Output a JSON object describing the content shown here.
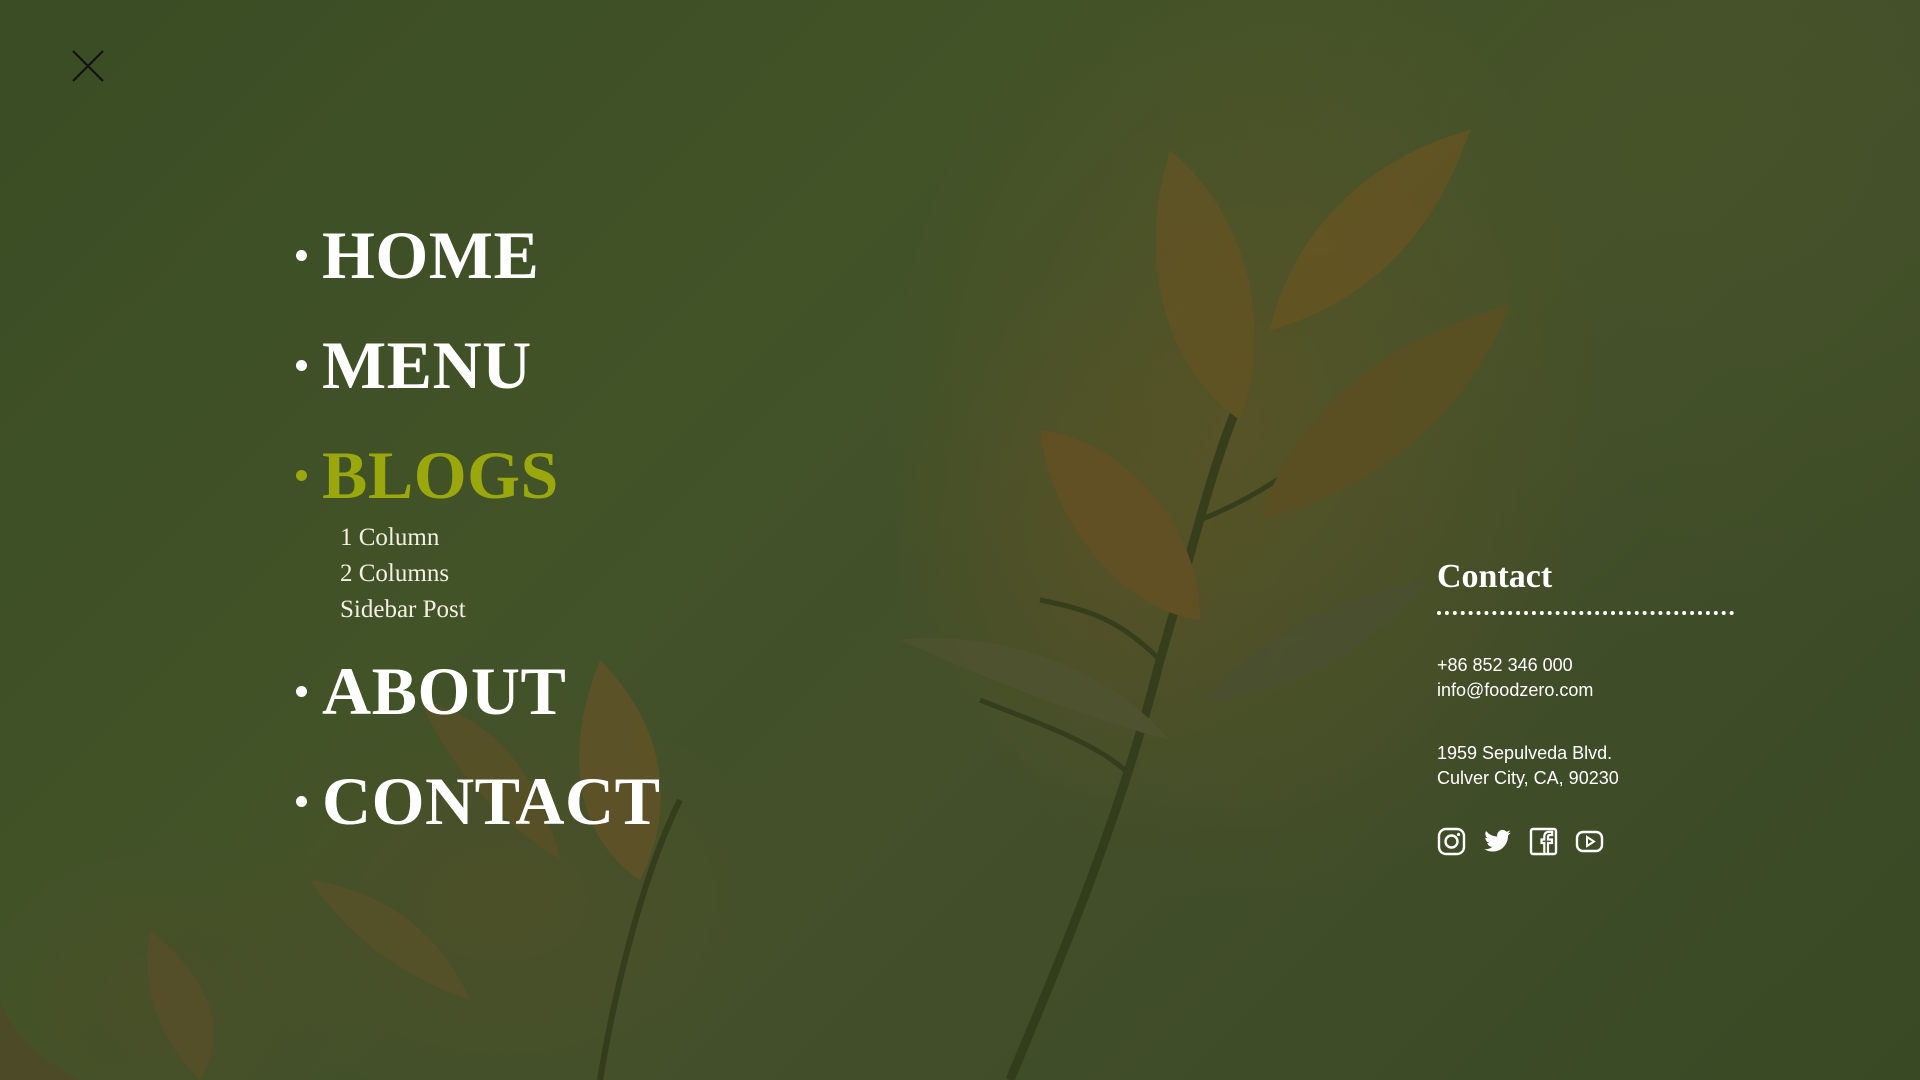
{
  "close": {
    "icon": "close-icon"
  },
  "nav": {
    "items": [
      {
        "label": "HOME",
        "active": false
      },
      {
        "label": "MENU",
        "active": false
      },
      {
        "label": "BLOGS",
        "active": true,
        "submenu": [
          "1 Column",
          "2 Columns",
          "Sidebar Post"
        ]
      },
      {
        "label": "ABOUT",
        "active": false
      },
      {
        "label": "CONTACT",
        "active": false
      }
    ],
    "active_color": "#9aa80e"
  },
  "contact": {
    "title": "Contact",
    "phone": "+86 852 346 000",
    "email": "info@foodzero.com",
    "address_line1": "1959 Sepulveda Blvd.",
    "address_line2": "Culver City, CA, 90230",
    "social": [
      "instagram-icon",
      "twitter-icon",
      "facebook-icon",
      "youtube-icon"
    ]
  }
}
